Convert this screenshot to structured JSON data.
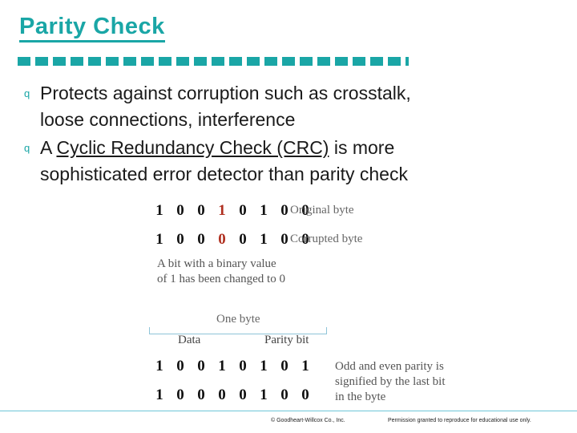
{
  "slide": {
    "title": "Parity Check",
    "accent_color": "#1aa6a6",
    "bullets": [
      {
        "marker": "q",
        "line1": "Protects against corruption such as crosstalk,",
        "line2": "loose connections, interference"
      },
      {
        "marker": "q",
        "pre": "A ",
        "link": "Cyclic Redundancy Check (CRC)",
        "post": " is more",
        "line2": "sophisticated error detector than parity check"
      }
    ]
  },
  "figure": {
    "original_byte": {
      "bits": [
        "1",
        "0",
        "0",
        "1",
        "0",
        "1",
        "0",
        "0"
      ],
      "highlight_index": 3,
      "label": "Original byte"
    },
    "corrupted_byte": {
      "bits": [
        "1",
        "0",
        "0",
        "0",
        "0",
        "1",
        "0",
        "0"
      ],
      "highlight_index": 3,
      "label": "Corrupted byte"
    },
    "change_note_line1": "A bit with a binary value",
    "change_note_line2": "of 1 has been changed to 0",
    "one_byte_label": "One byte",
    "data_label": "Data",
    "parity_bit_label": "Parity bit",
    "parity_rows": [
      {
        "data_bits": [
          "1",
          "0",
          "0",
          "1",
          "0",
          "1",
          "0"
        ],
        "parity": "1"
      },
      {
        "data_bits": [
          "1",
          "0",
          "0",
          "0",
          "0",
          "1",
          "0"
        ],
        "parity": "0"
      }
    ],
    "parity_note_line1": "Odd and even parity is",
    "parity_note_line2": "signified by the last bit",
    "parity_note_line3": "in the byte"
  },
  "footer": {
    "copyright": "© Goodheart-Willcox Co., Inc.",
    "permission": "Permission granted to reproduce for educational use only."
  }
}
